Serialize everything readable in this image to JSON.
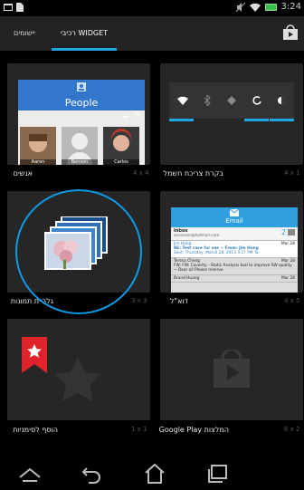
{
  "status_bar": {
    "time": "3:24",
    "icons": [
      "notification-icon",
      "file-icon",
      "mute-icon",
      "wifi-icon",
      "battery-icon"
    ]
  },
  "tabs": {
    "apps": "יישומים",
    "widgets": "רכיבי WIDGET"
  },
  "widgets": [
    {
      "name": "אנשים",
      "size": "4 x 4"
    },
    {
      "name": "בקרת צריכת חשמל",
      "size": "4 x 1"
    },
    {
      "name": "גלריית תמונות",
      "size": "3 x 3"
    },
    {
      "name": "דוא\"ל",
      "size": "4 x 5"
    },
    {
      "name": "הוסף לסימניות",
      "size": "1 x 1"
    },
    {
      "name": "המלצות Google Play",
      "size": "6 x 2"
    }
  ],
  "people_preview": {
    "title": "People",
    "contacts": [
      "Aaron",
      "Benson",
      "Carlos"
    ]
  },
  "email_preview": {
    "title": "Email",
    "inbox_label": "Inbox",
    "account": "asususer@hotmail.com",
    "unread_count": "2",
    "messages": [
      {
        "from": "Jim Hong",
        "subject": "RE: Test case for eas ~ From: Jim Hong",
        "sent": "Sent: Thursday, March 28, 2013 3:17 PM To:",
        "date": "Mar 28"
      },
      {
        "from": "Teresa Cheng",
        "subject": "FW: FW: Coverity - Static Analysis tool to improve SW quality ~ Dear all Please reserve",
        "date": "Mar 28"
      },
      {
        "from": "Brand Huang",
        "date": "Mar 28"
      }
    ]
  },
  "colors": {
    "accent": "#21a7e2",
    "people_header": "#3377cc",
    "email_header": "#2f9fe0",
    "bookmark_red": "#e0242b"
  }
}
